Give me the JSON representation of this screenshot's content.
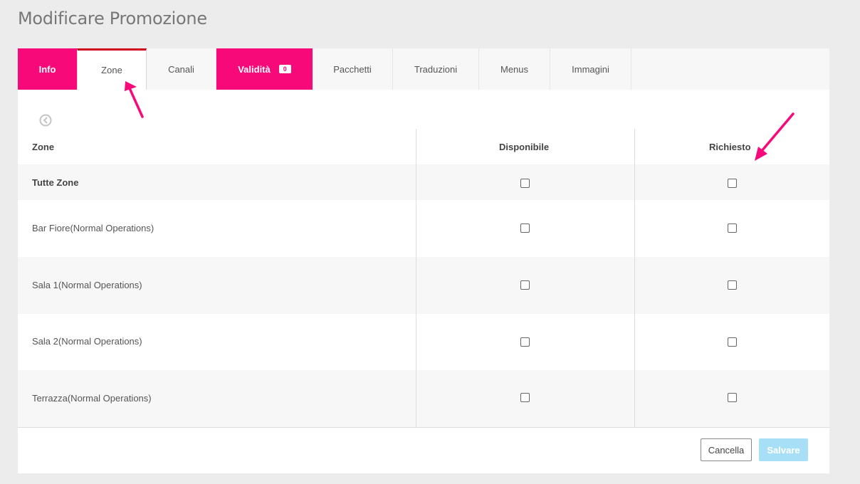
{
  "page": {
    "title": "Modificare Promozione"
  },
  "tabs": [
    {
      "label": "Info",
      "state": "highlight"
    },
    {
      "label": "Zone",
      "state": "active"
    },
    {
      "label": "Canali",
      "state": "normal"
    },
    {
      "label": "Validità",
      "badge": "0",
      "state": "highlight"
    },
    {
      "label": "Pacchetti",
      "state": "normal"
    },
    {
      "label": "Traduzioni",
      "state": "normal"
    },
    {
      "label": "Menus",
      "state": "normal"
    },
    {
      "label": "Immagini",
      "state": "normal"
    }
  ],
  "table": {
    "headers": {
      "zone": "Zone",
      "available": "Disponibile",
      "required": "Richiesto"
    },
    "rows": [
      {
        "label": "Tutte Zone",
        "available": false,
        "required": false
      },
      {
        "label": "Bar Fiore(Normal Operations)",
        "available": false,
        "required": false
      },
      {
        "label": "Sala 1(Normal Operations)",
        "available": false,
        "required": false
      },
      {
        "label": "Sala 2(Normal Operations)",
        "available": false,
        "required": false
      },
      {
        "label": "Terrazza(Normal Operations)",
        "available": false,
        "required": false
      }
    ]
  },
  "footer": {
    "cancel_label": "Cancella",
    "save_label": "Salvare"
  },
  "colors": {
    "accent": "#f7097a",
    "active_tab_border": "#d0021b",
    "save_button": "#a7e0f6",
    "annotation_arrow": "#f7097a"
  },
  "icons": {
    "back": "circle-chevron-left-icon"
  }
}
